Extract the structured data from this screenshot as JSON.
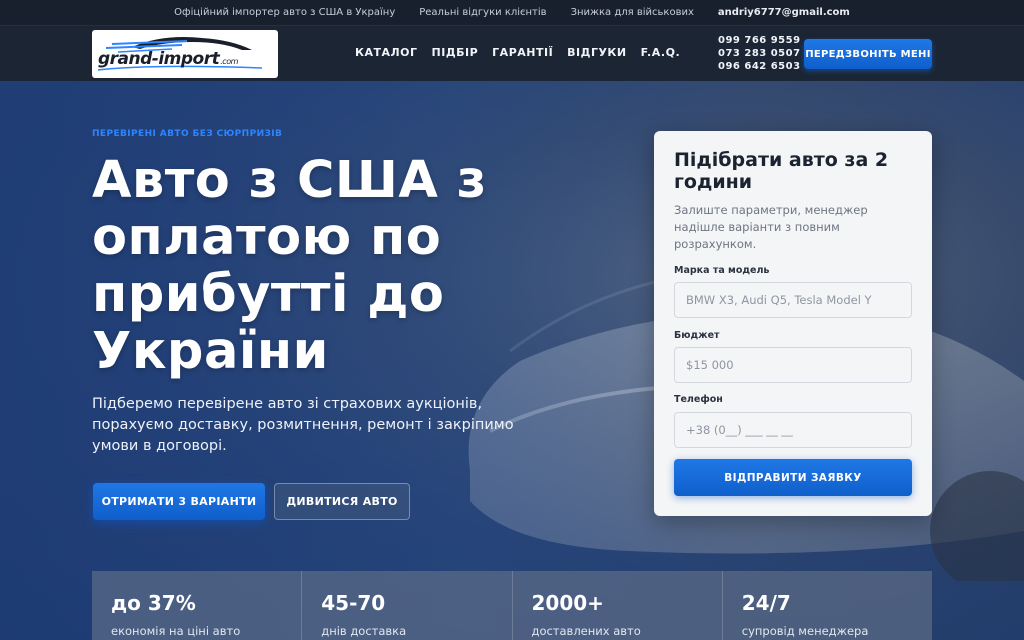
{
  "topbar": {
    "items": [
      "Офіційний імпортер авто з США в Україну",
      "Реальні відгуки клієнтів",
      "Знижка для військових"
    ],
    "email": "andriy6777@gmail.com"
  },
  "logo": {
    "text": "grand-import",
    "domain": ".com"
  },
  "nav": {
    "menu": [
      "КАТАЛОГ",
      "ПІДБІР",
      "ГАРАНТІЇ",
      "ВІДГУКИ",
      "F.A.Q."
    ],
    "phones": [
      "099 766 9559",
      "073 283 0507",
      "096 642 6503"
    ],
    "call_button": "ПЕРЕДЗВОНІТЬ МЕНІ"
  },
  "hero": {
    "eyebrow": "ПЕРЕВІРЕНІ АВТО БЕЗ СЮРПРИЗІВ",
    "headline": "Авто з США з оплатою по прибутті до України",
    "lead": "Підберемо перевірене авто зі страхових аукціонів, порахуємо доставку, розмитнення, ремонт і закріпимо умови в договорі.",
    "primary_button": "ОТРИМАТИ 3 ВАРІАНТИ",
    "secondary_button": "ДИВИТИСЯ АВТО"
  },
  "form": {
    "title": "Підібрати авто за 2 години",
    "description": "Залиште параметри, менеджер надішле варіанти з повним розрахунком.",
    "fields": [
      {
        "label": "Марка та модель",
        "placeholder": "BMW X3, Audi Q5, Tesla Model Y"
      },
      {
        "label": "Бюджет",
        "placeholder": "$15 000"
      },
      {
        "label": "Телефон",
        "placeholder": "+38 (0__) ___ __ __"
      }
    ],
    "submit": "ВІДПРАВИТИ ЗАЯВКУ"
  },
  "stats": [
    {
      "value": "до 37%",
      "label": "економія на ціні авто"
    },
    {
      "value": "45-70",
      "label": "днів доставка"
    },
    {
      "value": "2000+",
      "label": "доставлених авто"
    },
    {
      "value": "24/7",
      "label": "супровід менеджера"
    }
  ],
  "colors": {
    "accent": "#1f78e6",
    "eyebrow": "#2e86ff",
    "nav_bg": "#1b2533",
    "topbar_bg": "#17202c"
  }
}
